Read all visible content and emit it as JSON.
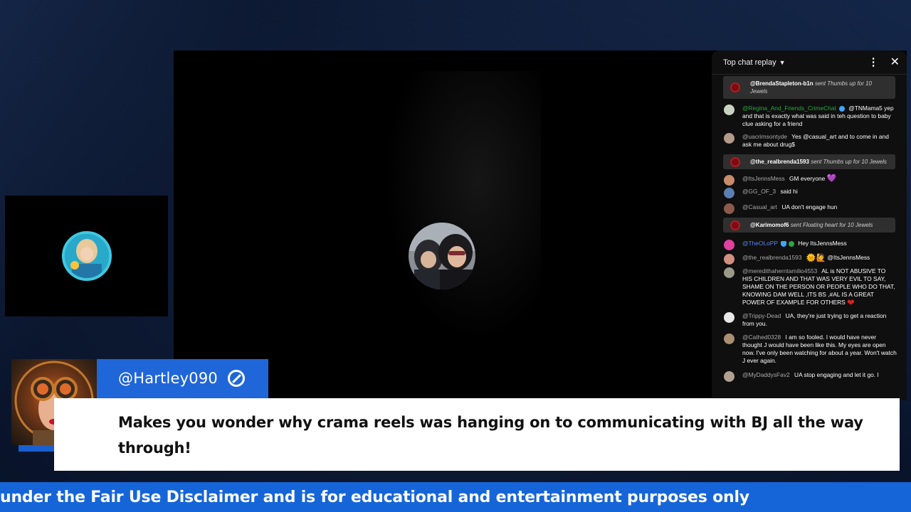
{
  "chat": {
    "title": "Top chat replay",
    "messages": [
      {
        "type": "gift",
        "author": "@BrendaStapleton-b1n",
        "text": "sent Thumbs up for 10 Jewels"
      },
      {
        "type": "msg",
        "author": "@Regina_And_Friends_CrimeChat",
        "mention": "@TNMama5",
        "text": "yep and that is exactly what was said in teh question to baby clue asking for a friend"
      },
      {
        "type": "msg",
        "author": "@uacrimsontyde",
        "text": "Yes @casual_art and to come in and ask me about drug$"
      },
      {
        "type": "gift",
        "author": "@the_realbrenda1593",
        "text": "sent Thumbs up for 10 Jewels"
      },
      {
        "type": "msg",
        "author": "@ItsJennsMess",
        "text": "GM everyone",
        "emoji": "💜"
      },
      {
        "type": "msg",
        "author": "@GG_OF_3",
        "text": "said hi"
      },
      {
        "type": "msg",
        "author": "@Casual_art",
        "text": "UA don't engage hun"
      },
      {
        "type": "gift",
        "author": "@Karimomof6",
        "text": "sent Floating heart for 10 Jewels"
      },
      {
        "type": "msg",
        "author": "@TheOLoPP",
        "text": "Hey ItsJennsMess"
      },
      {
        "type": "msg",
        "author": "@the_realbrenda1593",
        "emoji": "🌞🙋",
        "text": "@ItsJennsMess"
      },
      {
        "type": "msg",
        "author": "@meredithaherntamilio4553",
        "text": "AL is NOT ABUSIVE TO HIS CHILDREN AND THAT WAS VERY EVIL TO SAY, SHAME ON THE PERSON OR PEOPLE WHO DO THAT, KNOWING DAM WELL ,ITS BS ,#AL IS A GREAT POWER OF EXAMPLE FOR OTHERS",
        "emoji": "❤"
      },
      {
        "type": "msg",
        "author": "@Trippy-Dead",
        "text": "UA, they're just trying to get a reaction from you."
      },
      {
        "type": "msg",
        "author": "@Cathed0328",
        "text": "I am so fooled. I would have never thought J would have been like this. My eyes are open now. I've only been watching for about a year. Won't watch J ever again."
      },
      {
        "type": "msg",
        "author": "@MyDaddysFav2",
        "text": "UA stop engaging and let it go. I"
      }
    ]
  },
  "lower_third": {
    "handle": "@Hartley090",
    "comment": "Makes you wonder why crama reels was hanging on to communicating with BJ all the way through!"
  },
  "ticker": {
    "text": "under the Fair Use Disclaimer and is for educational and entertainment purposes only"
  },
  "colors": {
    "accent": "#1f66d9",
    "ticker": "#1565d8",
    "youtube": "#ff0000"
  }
}
